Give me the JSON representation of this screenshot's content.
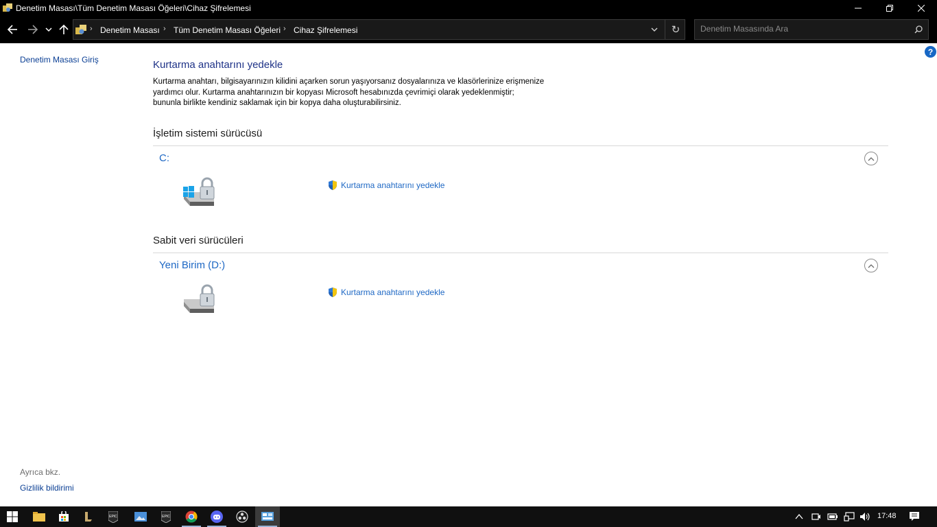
{
  "window": {
    "title": "Denetim Masası\\Tüm Denetim Masası Öğeleri\\Cihaz Şifrelemesi"
  },
  "breadcrumb": [
    "Denetim Masası",
    "Tüm Denetim Masası Öğeleri",
    "Cihaz Şifrelemesi"
  ],
  "search": {
    "placeholder": "Denetim Masasında Ara",
    "value": ""
  },
  "help": {
    "label": "?"
  },
  "sidebar": {
    "home_link": "Denetim Masası Giriş",
    "see_also_label": "Ayrıca bkz.",
    "privacy_link": "Gizlilik bildirimi"
  },
  "main": {
    "heading": "Kurtarma anahtarını yedekle",
    "description": [
      "Kurtarma anahtarı, bilgisayarınızın kilidini açarken sorun yaşıyorsanız dosyalarınıza ve klasörlerinize erişmenize",
      "yardımcı olur. Kurtarma anahtarınızın bir kopyası Microsoft hesabınızda çevrimiçi olarak yedeklenmiştir;",
      "bununla birlikte kendiniz saklamak için bir kopya daha oluşturabilirsiniz."
    ],
    "sections": [
      {
        "title": "İşletim sistemi sürücüsü",
        "drive": "C:",
        "action": "Kurtarma anahtarını yedekle"
      },
      {
        "title": "Sabit veri sürücüleri",
        "drive": "Yeni Birim (D:)",
        "action": "Kurtarma anahtarını yedekle"
      }
    ]
  },
  "taskbar": {
    "apps": [
      "start-icon",
      "file-explorer-icon",
      "store-icon",
      "league-of-legends-icon",
      "epic-games-icon",
      "photos-icon",
      "epic-games-icon",
      "chrome-icon",
      "discord-icon",
      "obs-icon",
      "control-panel-icon"
    ],
    "epic_label": "EPIC",
    "time": "17:48"
  },
  "colors": {
    "link": "#1e68c4",
    "heading": "#1e3287",
    "titlebar": "#000000",
    "taskbar": "#101010"
  }
}
